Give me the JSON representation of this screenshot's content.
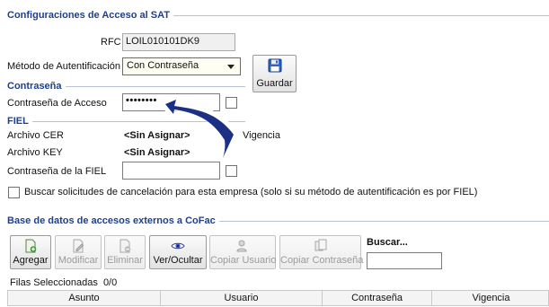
{
  "sat_section": {
    "title": "Configuraciones de Acceso al SAT",
    "rfc_label": "RFC",
    "rfc_value": "LOIL010101DK9",
    "auth_method_label": "Método de Autentificación",
    "auth_method_value": "Con Contraseña",
    "save_label": "Guardar"
  },
  "password_section": {
    "title": "Contraseña",
    "access_password_label": "Contraseña de Acceso",
    "access_password_value": "••••••••"
  },
  "fiel_section": {
    "title": "FIEL",
    "cer_label": "Archivo CER",
    "cer_value": "<Sin Asignar>",
    "vigencia_label": "Vigencia",
    "key_label": "Archivo KEY",
    "key_value": "<Sin Asignar>",
    "fiel_password_label": "Contraseña de la FIEL",
    "fiel_password_value": "",
    "cancel_search_label": "Buscar solicitudes de cancelación para esta empresa (solo si su método de autentificación es por FIEL)"
  },
  "external_section": {
    "title": "Base de datos de accesos externos a CoFac",
    "toolbar": {
      "add": "Agregar",
      "edit": "Modificar",
      "delete": "Eliminar",
      "toggle_view": "Ver/Ocultar",
      "copy_user": "Copiar Usuario",
      "copy_password": "Copiar Contraseña"
    },
    "search_label": "Buscar...",
    "search_value": "",
    "selected_rows": "Filas Seleccionadas  0/0",
    "columns": [
      "Asunto",
      "Usuario",
      "Contraseña",
      "Vigencia"
    ]
  },
  "icons": {
    "save": "floppy-disk-icon",
    "add": "add-document-icon",
    "edit": "edit-document-icon",
    "delete": "delete-document-icon",
    "toggle_view": "eye-icon",
    "copy_user": "copy-user-icon",
    "copy_password": "copy-password-icon",
    "annotation": "curved-arrow-pointer"
  },
  "colors": {
    "section_title": "#1f3f8c",
    "arrow_fill": "#1c2f86"
  }
}
